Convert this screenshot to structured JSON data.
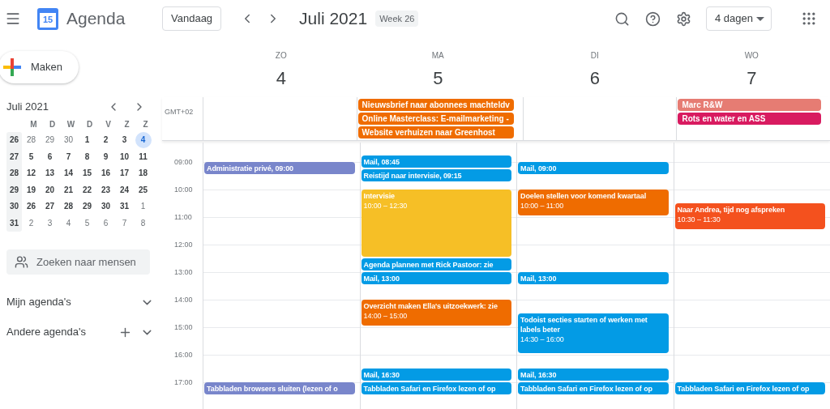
{
  "header": {
    "app_name": "Agenda",
    "logo_text": "15",
    "today_button": "Vandaag",
    "title": "Juli 2021",
    "week_badge": "Week 26",
    "view_select": "4 dagen"
  },
  "sidebar": {
    "create_button": "Maken",
    "mini_calendar": {
      "title": "Juli 2021",
      "weekdays": [
        "M",
        "D",
        "W",
        "D",
        "V",
        "Z",
        "Z"
      ],
      "weeks": [
        {
          "number": "26",
          "days": [
            {
              "label": "28",
              "in_month": false,
              "selected": false
            },
            {
              "label": "29",
              "in_month": false,
              "selected": false
            },
            {
              "label": "30",
              "in_month": false,
              "selected": false
            },
            {
              "label": "1",
              "in_month": true,
              "selected": false
            },
            {
              "label": "2",
              "in_month": true,
              "selected": false
            },
            {
              "label": "3",
              "in_month": true,
              "selected": false
            },
            {
              "label": "4",
              "in_month": true,
              "selected": true
            }
          ]
        },
        {
          "number": "27",
          "days": [
            {
              "label": "5",
              "in_month": true,
              "selected": false
            },
            {
              "label": "6",
              "in_month": true,
              "selected": false
            },
            {
              "label": "7",
              "in_month": true,
              "selected": false
            },
            {
              "label": "8",
              "in_month": true,
              "selected": false
            },
            {
              "label": "9",
              "in_month": true,
              "selected": false
            },
            {
              "label": "10",
              "in_month": true,
              "selected": false
            },
            {
              "label": "11",
              "in_month": true,
              "selected": false
            }
          ]
        },
        {
          "number": "28",
          "days": [
            {
              "label": "12",
              "in_month": true,
              "selected": false
            },
            {
              "label": "13",
              "in_month": true,
              "selected": false
            },
            {
              "label": "14",
              "in_month": true,
              "selected": false
            },
            {
              "label": "15",
              "in_month": true,
              "selected": false
            },
            {
              "label": "16",
              "in_month": true,
              "selected": false
            },
            {
              "label": "17",
              "in_month": true,
              "selected": false
            },
            {
              "label": "18",
              "in_month": true,
              "selected": false
            }
          ]
        },
        {
          "number": "29",
          "days": [
            {
              "label": "19",
              "in_month": true,
              "selected": false
            },
            {
              "label": "20",
              "in_month": true,
              "selected": false
            },
            {
              "label": "21",
              "in_month": true,
              "selected": false
            },
            {
              "label": "22",
              "in_month": true,
              "selected": false
            },
            {
              "label": "23",
              "in_month": true,
              "selected": false
            },
            {
              "label": "24",
              "in_month": true,
              "selected": false
            },
            {
              "label": "25",
              "in_month": true,
              "selected": false
            }
          ]
        },
        {
          "number": "30",
          "days": [
            {
              "label": "26",
              "in_month": true,
              "selected": false
            },
            {
              "label": "27",
              "in_month": true,
              "selected": false
            },
            {
              "label": "28",
              "in_month": true,
              "selected": false
            },
            {
              "label": "29",
              "in_month": true,
              "selected": false
            },
            {
              "label": "30",
              "in_month": true,
              "selected": false
            },
            {
              "label": "31",
              "in_month": true,
              "selected": false
            },
            {
              "label": "1",
              "in_month": false,
              "selected": false
            }
          ]
        },
        {
          "number": "31",
          "days": [
            {
              "label": "2",
              "in_month": false,
              "selected": false
            },
            {
              "label": "3",
              "in_month": false,
              "selected": false
            },
            {
              "label": "4",
              "in_month": false,
              "selected": false
            },
            {
              "label": "5",
              "in_month": false,
              "selected": false
            },
            {
              "label": "6",
              "in_month": false,
              "selected": false
            },
            {
              "label": "7",
              "in_month": false,
              "selected": false
            },
            {
              "label": "8",
              "in_month": false,
              "selected": false
            }
          ]
        }
      ]
    },
    "people_search": {
      "placeholder": "Zoeken naar mensen"
    },
    "sections": [
      {
        "label": "Mijn agenda's",
        "add": false
      },
      {
        "label": "Andere agenda's",
        "add": true
      }
    ]
  },
  "calendar": {
    "timezone": "GMT+02",
    "days": [
      {
        "name": "ZO",
        "number": "4"
      },
      {
        "name": "MA",
        "number": "5",
        "all_day": [
          {
            "title": "Nieuwsbrief naar abonnees machteldv",
            "color": "#ef6c00"
          },
          {
            "title": "Online Masterclass: E-mailmarketing -",
            "color": "#ef6c00"
          },
          {
            "title": "Website verhuizen naar Greenhost",
            "color": "#ef6c00"
          }
        ]
      },
      {
        "name": "DI",
        "number": "6"
      },
      {
        "name": "WO",
        "number": "7",
        "all_day": [
          {
            "title": "Marc R&W",
            "color": "#e67c73"
          },
          {
            "title": "Rots en water en ASS",
            "color": "#d81b60"
          }
        ]
      }
    ],
    "hours": [
      {
        "label": "09:00",
        "day_1": [
          {
            "title": "Administratie privé, 09:00",
            "color": "#7986cb"
          }
        ],
        "day_2": [
          {
            "title": "Mail, 08:45",
            "color": "#039be5"
          },
          {
            "title": "Reistijd naar intervisie, 09:15",
            "color": "#039be5"
          }
        ],
        "day_3": [
          {
            "title": "Mail, 09:00",
            "color": "#039be5"
          }
        ]
      },
      {
        "label": "10:00",
        "day_2": [
          {
            "title": "Intervisie",
            "time": "10:00 – 12:30",
            "color": "#f6bf26"
          }
        ],
        "day_3": [
          {
            "title": "Doelen stellen voor komend kwartaal",
            "time": "10:00 – 11:00",
            "color": "#ef6c00"
          }
        ],
        "day_4": [
          {
            "title": "Naar Andrea, tijd nog afspreken",
            "time": "10:30 – 11:30",
            "color": "#f4511e"
          }
        ]
      },
      {
        "label": "11:00"
      },
      {
        "label": "12:00",
        "day_2": [
          {
            "title": "Agenda plannen met Rick Pastoor: zie",
            "color": "#039be5"
          }
        ]
      },
      {
        "label": "13:00",
        "day_2": [
          {
            "title": "Mail, 13:00",
            "color": "#039be5"
          }
        ],
        "day_3": [
          {
            "title": "Mail, 13:00",
            "color": "#039be5"
          }
        ]
      },
      {
        "label": "14:00",
        "day_2": [
          {
            "title": "Overzicht maken Ella's uitzoekwerk: zie",
            "time": "14:00 – 15:00",
            "color": "#ef6c00"
          }
        ],
        "day_3": [
          {
            "title": "Todoist secties starten of werken met labels beter",
            "time": "14:30 – 16:00",
            "color": "#039be5"
          }
        ]
      },
      {
        "label": "15:00"
      },
      {
        "label": "16:00",
        "day_2": [
          {
            "title": "Mail, 16:30",
            "color": "#039be5"
          }
        ],
        "day_3": [
          {
            "title": "Mail, 16:30",
            "color": "#039be5"
          }
        ]
      },
      {
        "label": "17:00",
        "day_1": [
          {
            "title": "Tabbladen browsers sluiten (lezen of o",
            "color": "#7986cb"
          }
        ],
        "day_2": [
          {
            "title": "Tabbladen Safari en Firefox lezen of op",
            "color": "#039be5"
          }
        ],
        "day_3": [
          {
            "title": "Tabbladen Safari en Firefox lezen of op",
            "color": "#039be5"
          }
        ],
        "day_4": [
          {
            "title": "Tabbladen Safari en Firefox lezen of op",
            "color": "#039be5"
          }
        ]
      }
    ]
  }
}
